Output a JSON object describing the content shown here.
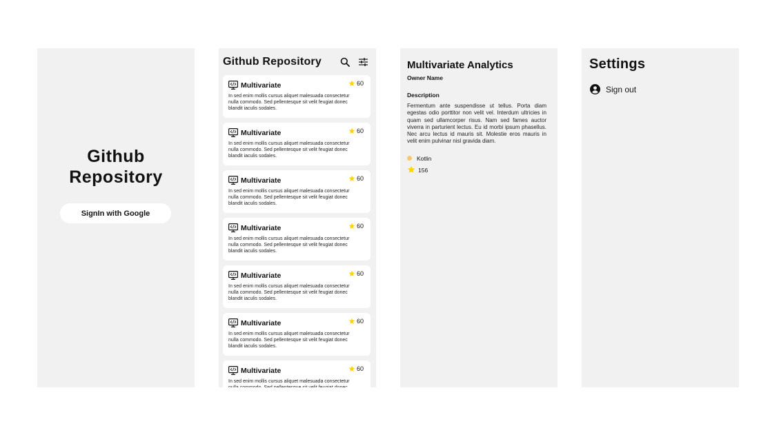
{
  "login": {
    "title_line1": "Github",
    "title_line2": "Repository",
    "google_button": "SignIn with Google"
  },
  "list": {
    "title": "Github Repository",
    "icons": [
      "search-icon",
      "filter-icon"
    ],
    "repos": [
      {
        "name": "Multivariate",
        "stars": "60",
        "desc": "In sed enim mollis cursus aliquet malesuada consectetur nulla commodo. Sed pellentesque sit velit feugiat donec blandit iaculis sodales."
      },
      {
        "name": "Multivariate",
        "stars": "60",
        "desc": "In sed enim mollis cursus aliquet malesuada consectetur nulla commodo. Sed pellentesque sit velit feugiat donec blandit iaculis sodales."
      },
      {
        "name": "Multivariate",
        "stars": "60",
        "desc": "In sed enim mollis cursus aliquet malesuada consectetur nulla commodo. Sed pellentesque sit velit feugiat donec blandit iaculis sodales."
      },
      {
        "name": "Multivariate",
        "stars": "60",
        "desc": "In sed enim mollis cursus aliquet malesuada consectetur nulla commodo. Sed pellentesque sit velit feugiat donec blandit iaculis sodales."
      },
      {
        "name": "Multivariate",
        "stars": "60",
        "desc": "In sed enim mollis cursus aliquet malesuada consectetur nulla commodo. Sed pellentesque sit velit feugiat donec blandit iaculis sodales."
      },
      {
        "name": "Multivariate",
        "stars": "60",
        "desc": "In sed enim mollis cursus aliquet malesuada consectetur nulla commodo. Sed pellentesque sit velit feugiat donec blandit iaculis sodales."
      },
      {
        "name": "Multivariate",
        "stars": "60",
        "desc": "In sed enim mollis cursus aliquet malesuada consectetur nulla commodo. Sed pellentesque sit velit feugiat donec blandit iaculis sodales."
      }
    ]
  },
  "detail": {
    "title": "Multivariate Analytics",
    "owner": "Owner Name",
    "description_label": "Description",
    "description": "Fermentum ante suspendisse ut tellus. Porta diam egestas odio porttitor non velit vel. Interdum ultricies in quam sed ullamcorper risus. Nam sed fames auctor viverra in parturient lectus. Eu id morbi ipsum phasellus. Nec arcu lectus id mauris sit. Molestie eros mauris in velit enim pulvinar nisl gravida diam.",
    "language": "Kotlin",
    "language_color": "#f7c86b",
    "stars": "156"
  },
  "settings": {
    "title": "Settings",
    "sign_out": "Sign out"
  },
  "colors": {
    "screen_bg": "#f1f1f1",
    "star": "#ffd400"
  }
}
